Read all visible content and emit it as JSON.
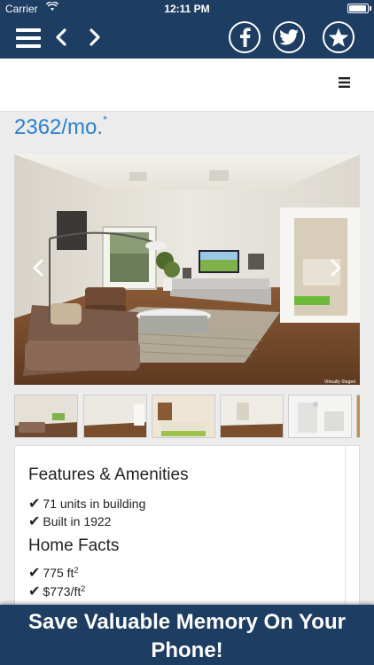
{
  "status": {
    "carrier": "Carrier",
    "time": "12:11 PM"
  },
  "listing": {
    "price": "2362/mo.",
    "price_note": "*"
  },
  "photo": {
    "watermark": "Virtually Staged"
  },
  "features": {
    "title": "Features & Amenities",
    "items": [
      "71 units in building",
      "Built in 1922"
    ]
  },
  "home_facts": {
    "title": "Home Facts",
    "size_value": "775 ft",
    "size_sup": "2",
    "price_value": "$773/ft",
    "price_sup": "2"
  },
  "banner": {
    "line1": "Save Valuable Memory On Your",
    "line2": "Phone!"
  },
  "colors": {
    "nav": "#1d3d63",
    "price": "#2a7fd4"
  },
  "icons": [
    "menu-icon",
    "back-icon",
    "forward-icon",
    "facebook-icon",
    "twitter-icon",
    "star-icon",
    "hamburger-icon",
    "check-icon"
  ]
}
